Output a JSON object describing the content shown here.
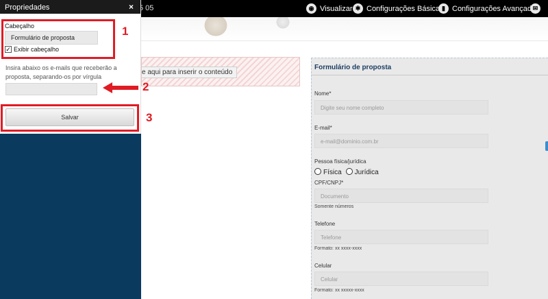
{
  "topbar": {
    "crumb": "5 05",
    "visualizar": "Visualizar",
    "config_basicas": "Configurações Básicas",
    "config_avancadas": "Configurações Avançadas"
  },
  "panel": {
    "title": "Propriedades",
    "close": "×",
    "header_label": "Cabeçalho",
    "header_value": "Formulário de proposta",
    "show_header_label": "Exibir cabeçalho",
    "show_header_checked": true,
    "emails_label": "Insira abaixo os e-mails que receberão a proposta, separando-os por vírgula",
    "emails_value": "",
    "save": "Salvar"
  },
  "annotations": {
    "n1": "1",
    "n2": "2",
    "n3": "3",
    "color": "#e01b24"
  },
  "content": {
    "placeholder_button": "e aqui para inserir o conteúdo"
  },
  "form": {
    "title": "Formulário de proposta",
    "name_label": "Nome*",
    "name_placeholder": "Digite seu nome completo",
    "email_label": "E-mail*",
    "email_placeholder": "e-mail@dominio.com.br",
    "person_label": "Pessoa física/jurídica",
    "opt_fisica": "Física",
    "opt_juridica": "Jurídica",
    "doc_label": "CPF/CNPJ*",
    "doc_placeholder": "Documento",
    "doc_hint": "Somente números",
    "phone_label": "Telefone",
    "phone_placeholder": "Telefone",
    "phone_hint": "Formato: xx xxxx-xxxx",
    "cell_label": "Celular",
    "cell_placeholder": "Celular",
    "cell_hint": "Formato: xx xxxxx-xxxx"
  }
}
